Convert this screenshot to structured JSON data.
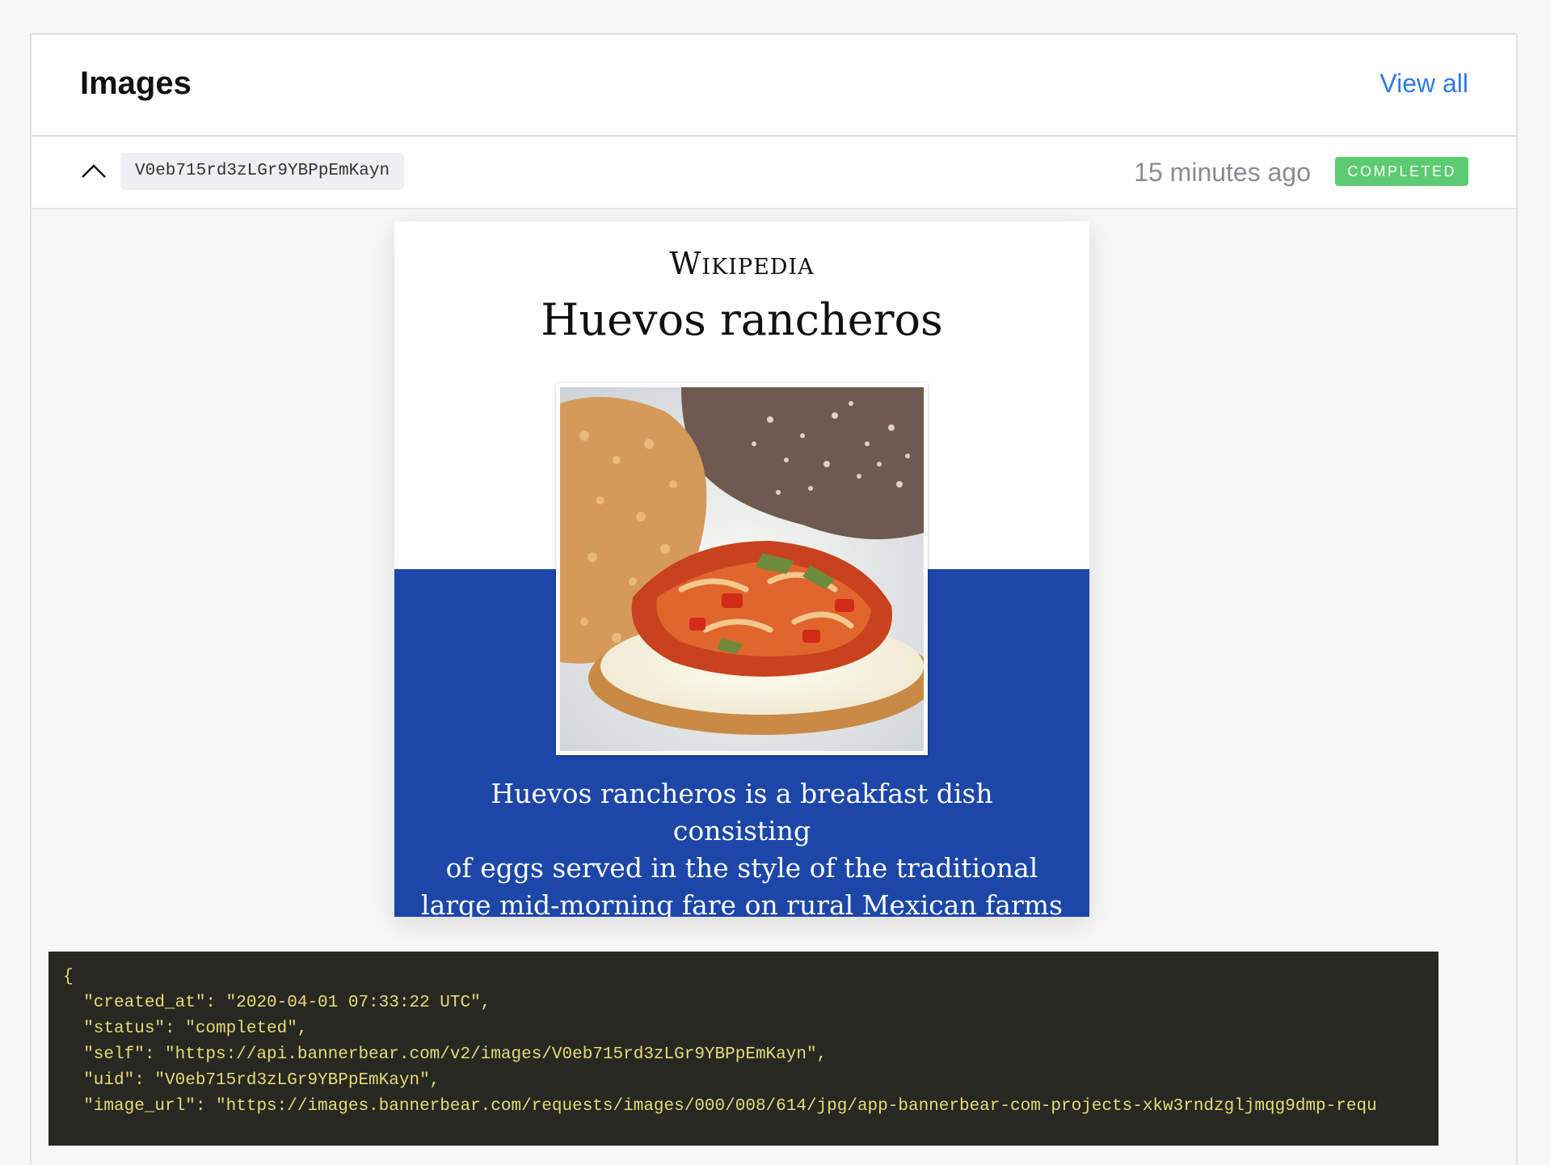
{
  "section": {
    "title": "Images",
    "view_all_label": "View all"
  },
  "image_row": {
    "uid": "V0eb715rd3zLGr9YBPpEmKayn",
    "time_ago": "15 minutes ago",
    "status_label": "COMPLETED",
    "expand_icon": "chevron-up-icon"
  },
  "preview": {
    "logo_text": "Wikipedia",
    "title": "Huevos rancheros",
    "caption_lines": [
      "Huevos rancheros  is a breakfast dish consisting",
      "of eggs served in the style of the traditional",
      "large mid-morning fare on rural Mexican farms"
    ],
    "photo_subject": "plate of huevos rancheros with rice and beans"
  },
  "json_response": {
    "lines": [
      "{",
      "  \"created_at\": \"2020-04-01 07:33:22 UTC\",",
      "  \"status\": \"completed\",",
      "  \"self\": \"https://api.bannerbear.com/v2/images/V0eb715rd3zLGr9YBPpEmKayn\",",
      "  \"uid\": \"V0eb715rd3zLGr9YBPpEmKayn\",",
      "  \"image_url\": \"https://images.bannerbear.com/requests/images/000/008/614/jpg/app-bannerbear-com-projects-xkw3rndzgljmqg9dmp-requ"
    ]
  },
  "colors": {
    "accent_link": "#2f7ae5",
    "status_green": "#5dcb72",
    "preview_blue": "#1c46a8",
    "code_bg": "#272822",
    "code_text": "#e6db74"
  }
}
